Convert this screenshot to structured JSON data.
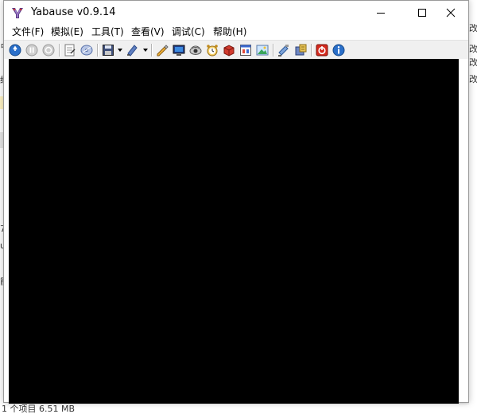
{
  "window": {
    "title": "Yabause v0.9.14"
  },
  "menu": [
    {
      "label": "文件(F)"
    },
    {
      "label": "模拟(E)"
    },
    {
      "label": "工具(T)"
    },
    {
      "label": "查看(V)"
    },
    {
      "label": "调试(C)"
    },
    {
      "label": "帮助(H)"
    }
  ],
  "background": {
    "left_glyphs": [
      "占",
      "级",
      "7",
      "u",
      "能"
    ],
    "right_glyphs": [
      "改",
      "改",
      "改",
      "改"
    ],
    "status": "1 个项目  6.51 MB"
  },
  "colors": {
    "screen": "#000000",
    "titlebar": "#ffffff",
    "toolbar": "#f0f0f0"
  }
}
